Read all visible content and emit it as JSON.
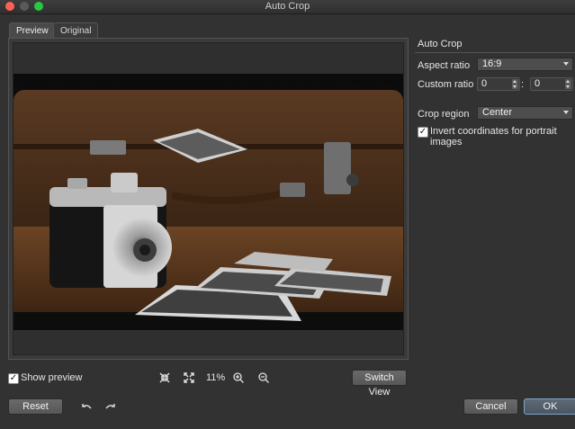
{
  "window": {
    "title": "Auto Crop"
  },
  "tabs": [
    {
      "label": "Preview",
      "active": true
    },
    {
      "label": "Original",
      "active": false
    }
  ],
  "preview": {
    "show_preview_label": "Show preview",
    "show_preview_checked": true,
    "zoom": "11%",
    "switch_view_label": "Switch View"
  },
  "settings": {
    "title": "Auto Crop",
    "aspect_ratio": {
      "label": "Aspect ratio",
      "value": "16:9"
    },
    "custom_ratio": {
      "label": "Custom ratio",
      "width": "0",
      "separator": ":",
      "height": "0"
    },
    "crop_region": {
      "label": "Crop region",
      "value": "Center"
    },
    "invert": {
      "label": "Invert coordinates for portrait images",
      "checked": true
    }
  },
  "buttons": {
    "reset": "Reset",
    "cancel": "Cancel",
    "ok": "OK"
  },
  "icons": {
    "fit": "shrink-arrows-icon",
    "full": "expand-arrows-icon",
    "zoom_in": "zoom-in-icon",
    "zoom_out": "zoom-out-icon",
    "undo": "undo-icon",
    "redo": "redo-icon"
  }
}
